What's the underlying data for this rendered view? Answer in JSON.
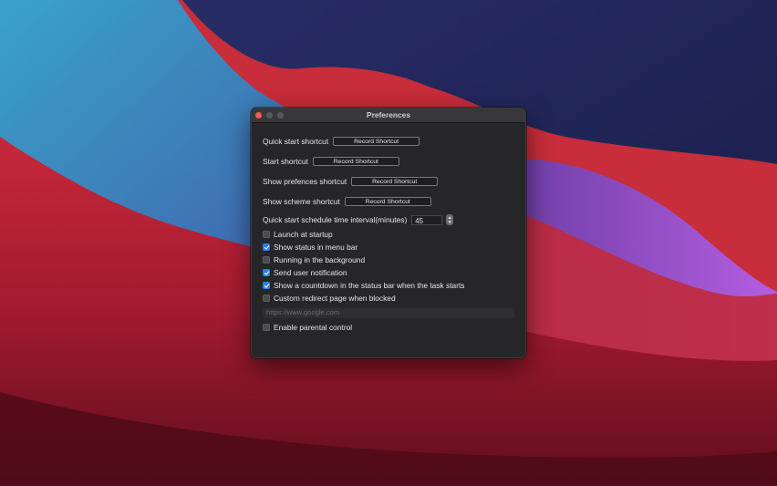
{
  "window": {
    "title": "Preferences"
  },
  "shortcuts": [
    {
      "label": "Quick start shortcut",
      "button": "Record Shortcut"
    },
    {
      "label": "Start shortcut",
      "button": "Record Shortcut"
    },
    {
      "label": "Show prefences shortcut",
      "button": "Record Shortcut"
    },
    {
      "label": "Show scheme shortcut",
      "button": "Record Shortcut"
    }
  ],
  "interval": {
    "label": "Quick start schedule time interval(minutes)",
    "value": "45"
  },
  "options": [
    {
      "label": "Launch at startup",
      "checked": false
    },
    {
      "label": "Show status in menu bar",
      "checked": true
    },
    {
      "label": "Running in the background",
      "checked": false
    },
    {
      "label": "Send user notification",
      "checked": true
    },
    {
      "label": "Show a countdown in the status bar when the task starts",
      "checked": true
    },
    {
      "label": "Custom redirect page when blocked",
      "checked": false
    }
  ],
  "redirect": {
    "placeholder": "https://www.google.com"
  },
  "parental": {
    "label": "Enable parental control",
    "checked": false
  },
  "colors": {
    "accent": "#2b7cf0",
    "close": "#ee5b55",
    "window_bg": "#262628"
  },
  "icons": {
    "check": "checkmark-icon",
    "stepper": "up-down-arrows-icon"
  }
}
